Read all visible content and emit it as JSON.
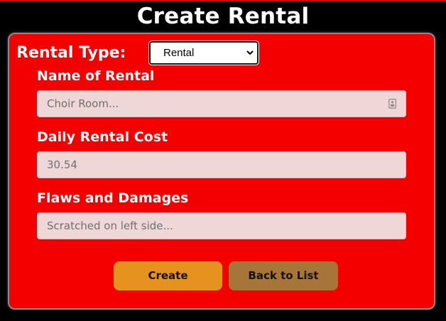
{
  "page": {
    "title": "Create Rental"
  },
  "form": {
    "type_label": "Rental Type:",
    "type_select": {
      "selected": "Rental"
    },
    "name": {
      "label": "Name of Rental",
      "placeholder": "Choir Room..."
    },
    "cost": {
      "label": "Daily Rental Cost",
      "placeholder": "30.54"
    },
    "flaws": {
      "label": "Flaws and Damages",
      "placeholder": "Scratched on left side..."
    }
  },
  "buttons": {
    "create": "Create",
    "back": "Back to List"
  },
  "colors": {
    "background": "#000000",
    "panel": "#f40000",
    "input_bg": "#efd7d7",
    "create_button": "#e6921f",
    "back_button": "#a87538"
  }
}
